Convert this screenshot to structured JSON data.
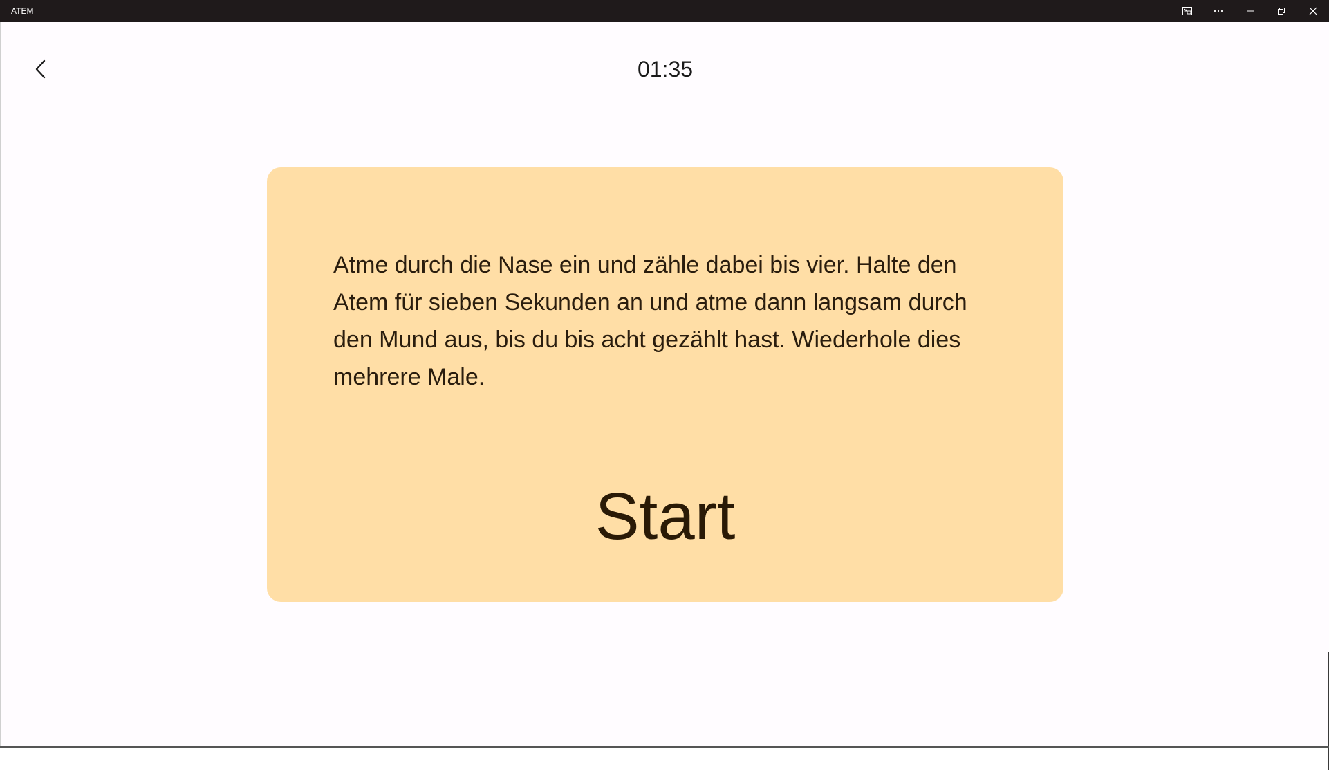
{
  "window": {
    "title": "ATEM",
    "controls": {
      "compact_overlay_icon": "compact-overlay-icon",
      "more_icon": "more-icon",
      "minimize_icon": "minimize-icon",
      "restore_icon": "restore-icon",
      "close_icon": "close-icon"
    }
  },
  "header": {
    "back_icon": "chevron-left-icon",
    "timer": "01:35"
  },
  "card": {
    "instruction": "Atme durch die Nase ein und zähle dabei bis vier. Halte den Atem für sieben Sekunden an und atme dann langsam durch den Mund aus, bis du bis acht gezählt hast. Wiederhole dies mehrere Male.",
    "start_label": "Start",
    "background_color": "#ffdea6"
  },
  "colors": {
    "titlebar": "#1f1a1b",
    "page_background": "#fffcff",
    "text": "#2a1d0e"
  }
}
